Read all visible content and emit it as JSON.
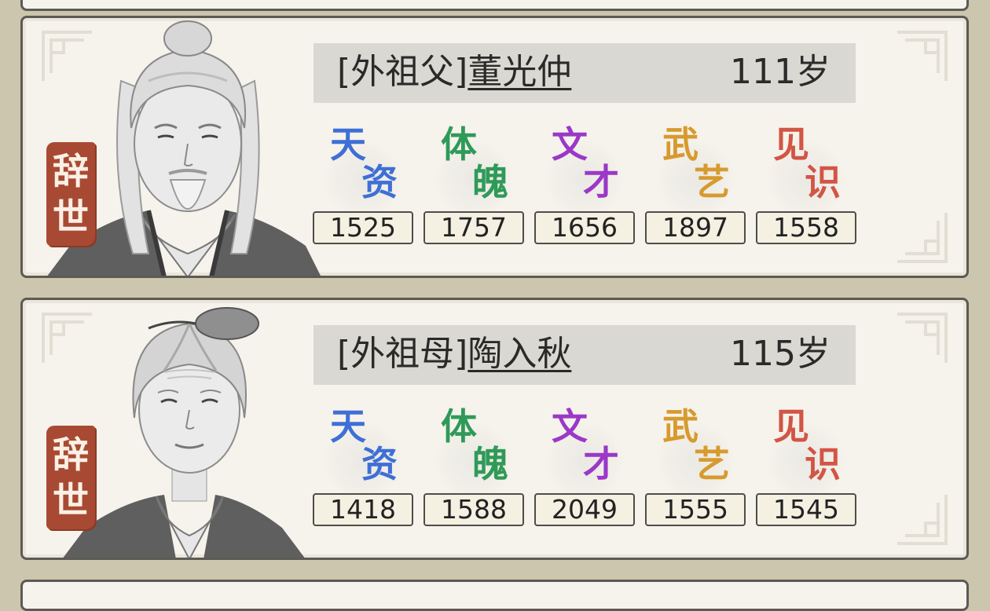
{
  "colors": {
    "tianzi": "#3f6fd6",
    "tipo": "#2f9a58",
    "wencai": "#9b38c8",
    "wuyi": "#d79a2e",
    "jianshi": "#d25545",
    "seal": "#a84a33",
    "card_bg": "#f6f3ec",
    "page_bg": "#cdc6ae"
  },
  "attribute_labels": [
    {
      "top": "天",
      "bottom": "资",
      "color_key": "tianzi"
    },
    {
      "top": "体",
      "bottom": "魄",
      "color_key": "tipo"
    },
    {
      "top": "文",
      "bottom": "才",
      "color_key": "wencai"
    },
    {
      "top": "武",
      "bottom": "艺",
      "color_key": "wuyi"
    },
    {
      "top": "见",
      "bottom": "识",
      "color_key": "jianshi"
    }
  ],
  "relatives": [
    {
      "relation": "[外祖父]",
      "name": "董光仲",
      "age": "111岁",
      "status_char1": "辞",
      "status_char2": "世",
      "portrait": "elderly-man-portrait",
      "stats": [
        "1525",
        "1757",
        "1656",
        "1897",
        "1558"
      ]
    },
    {
      "relation": "[外祖母]",
      "name": "陶入秋",
      "age": "115岁",
      "status_char1": "辞",
      "status_char2": "世",
      "portrait": "elderly-woman-portrait",
      "stats": [
        "1418",
        "1588",
        "2049",
        "1555",
        "1545"
      ]
    }
  ]
}
